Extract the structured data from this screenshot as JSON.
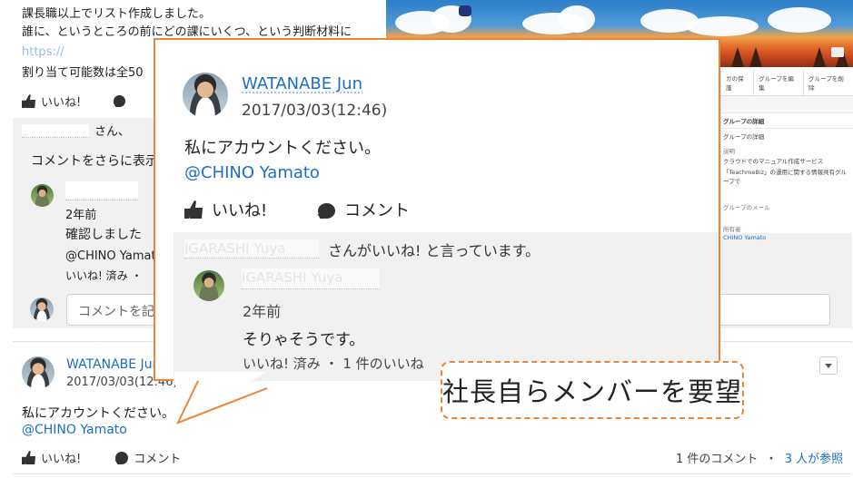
{
  "top_post": {
    "line1": "課長職以上でリスト作成しました。",
    "line2": "誰に、というところの前にどの課にいくつ、という判断材料に",
    "line3_prefix": "https://",
    "line4": "割り当て可能数は全50"
  },
  "actions": {
    "like": "いいね!",
    "comment": "コメント"
  },
  "liked_by_suffix": "さん、",
  "more_comments": "コメントをさらに表示",
  "bg_comment": {
    "time": "2年前",
    "text": "確認しました",
    "mention": "@CHINO Yamato",
    "status": "いいね! 済み ・"
  },
  "comment_placeholder": "コメントを記",
  "post": {
    "author": "WATANABE Jun",
    "time": "2017/03/03(12:46)",
    "body": "私にアカウントください。",
    "mention": "@CHINO Yamato",
    "stats_comments": "1 件のコメント",
    "stats_sep": "・",
    "stats_views": "3 人が参照"
  },
  "popup": {
    "author": "WATANABE Jun",
    "time": "2017/03/03(12:46)",
    "body": "私にアカウントください。",
    "mention": "@CHINO Yamato",
    "like": "いいね!",
    "comment": "コメント",
    "liker_name": "IGARASHI Yuya",
    "liked_text": "さんがいいね! と言っています。",
    "reply_author": "IGARASHI Yuya",
    "reply_time": "2年前",
    "reply_text": "そりゃそうです。",
    "reply_status": "いいね! 済み ・ 1 件のいいね"
  },
  "callout": "社長自らメンバーを要望",
  "side_panel": {
    "tabs": [
      "ガの保護",
      "グループを編集",
      "グループを削除"
    ],
    "heading": "グループの詳細",
    "subheading": "グループの詳細",
    "desc_label": "説明",
    "desc_line1": "クラウドでのマニュアル作成サービス",
    "desc_line2": "「TeachmeBiz」の運用に関する情報共有グループで",
    "email_label": "グループのメール",
    "owner_label": "所有者",
    "owner": "CHINO Yamato"
  },
  "colors": {
    "accent": "#ea8537",
    "link": "#1a6fc4"
  },
  "icons": [
    "thumbs-up-icon",
    "speech-bubble-icon",
    "camera-icon",
    "chevron-down-icon"
  ]
}
